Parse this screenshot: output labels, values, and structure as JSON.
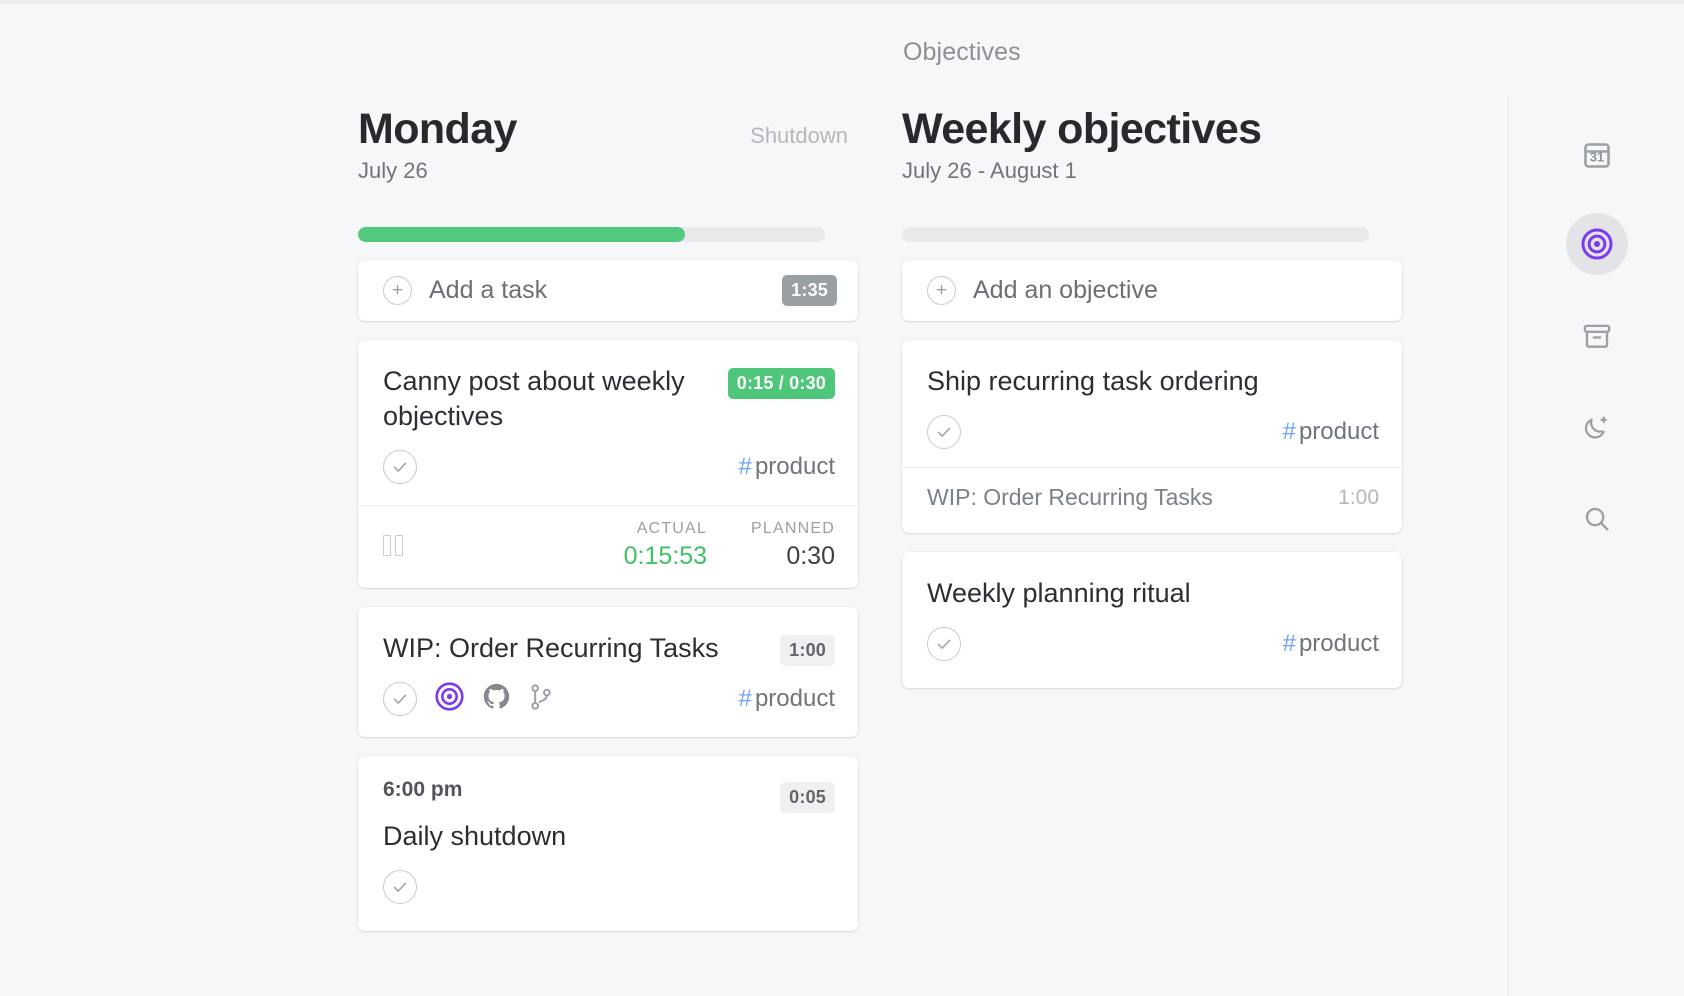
{
  "section_label": "Objectives",
  "day_column": {
    "title": "Monday",
    "subtitle": "July 26",
    "status_label": "Shutdown",
    "progress_percent": 70,
    "progress_color": "#52c97c",
    "add_row": {
      "label": "Add a task",
      "total_badge": "1:35",
      "plus_icon": "plus-icon"
    },
    "tasks": [
      {
        "title": "Canny post about weekly objectives",
        "time_chip": "0:15 / 0:30",
        "time_chip_style": "green",
        "tag": "product",
        "tag_hash": "#",
        "timer": {
          "pause_icon": "pause-icon",
          "actual_label": "ACTUAL",
          "actual_value": "0:15:53",
          "planned_label": "PLANNED",
          "planned_value": "0:30"
        }
      },
      {
        "title": "WIP: Order Recurring Tasks",
        "time_chip": "1:00",
        "time_chip_style": "grey",
        "tag": "product",
        "tag_hash": "#",
        "icons": [
          "check-circle-icon",
          "target-icon",
          "github-icon",
          "git-branch-icon"
        ]
      },
      {
        "time_prefix": "6:00 pm",
        "title": "Daily shutdown",
        "time_chip": "0:05",
        "time_chip_style": "grey"
      }
    ]
  },
  "objectives_column": {
    "title": "Weekly objectives",
    "subtitle": "July 26 - August 1",
    "progress_percent": 0,
    "add_row": {
      "label": "Add an objective",
      "plus_icon": "plus-icon"
    },
    "objectives": [
      {
        "title": "Ship recurring task ordering",
        "tag": "product",
        "tag_hash": "#",
        "sub_task": {
          "title": "WIP: Order Recurring Tasks",
          "time": "1:00"
        }
      },
      {
        "title": "Weekly planning ritual",
        "tag": "product",
        "tag_hash": "#"
      }
    ]
  },
  "right_rail": {
    "items": [
      {
        "icon": "calendar-icon",
        "day_number": "31",
        "active": false
      },
      {
        "icon": "target-icon",
        "active": true
      },
      {
        "icon": "archive-icon",
        "active": false
      },
      {
        "icon": "moon-icon",
        "active": false
      },
      {
        "icon": "search-icon",
        "active": false
      }
    ]
  },
  "colors": {
    "accent_purple": "#7c3aed",
    "green": "#4ec77a",
    "tag_blue": "#6fa1f5",
    "background": "#f6f7f9"
  }
}
